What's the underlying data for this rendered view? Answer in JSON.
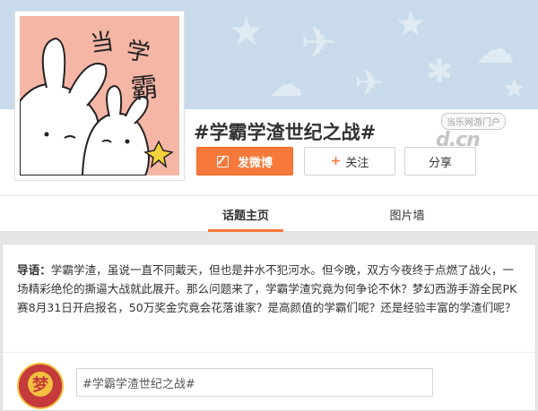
{
  "topic": {
    "title": "#学霸学渣世纪之战#",
    "avatar_text": [
      "当",
      "学",
      "霸"
    ]
  },
  "actions": {
    "post_label": "发微博",
    "follow_plus": "+",
    "follow_label": "关注",
    "share_label": "分享"
  },
  "tabs": [
    {
      "label": "话题主页",
      "active": true
    },
    {
      "label": "图片墙",
      "active": false
    }
  ],
  "intro": {
    "lead": "导语：",
    "text": "学霸学渣，虽说一直不同戴天，但也是井水不犯河水。但今晚，双方今夜终于点燃了战火，一场精彩绝伦的撕逼大战就此展开。那么问题来了，学霸学渣究竟为何争论不休？梦幻西游手游全民PK赛8月31日开启报名，50万奖金究竟会花落谁家？是高颜值的学霸们呢？还是经验丰富的学渣们呢？"
  },
  "composer": {
    "input_value": "#学霸学渣世纪之战#"
  },
  "watermark": {
    "site_name": "当乐网游门户",
    "url": "d.cn"
  },
  "colors": {
    "accent": "#f6793a",
    "banner": "#c9dbea",
    "avatar_bg": "#f6b6a6"
  }
}
